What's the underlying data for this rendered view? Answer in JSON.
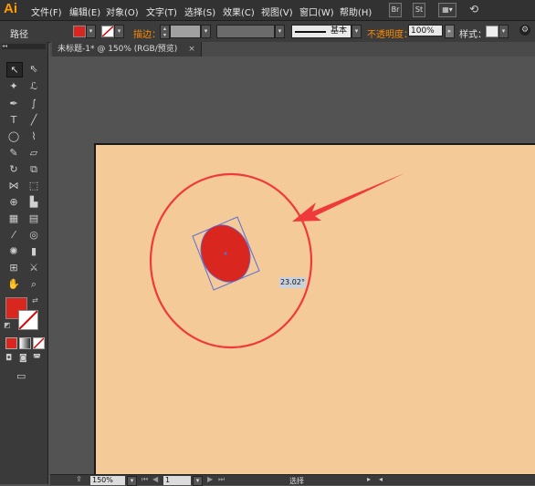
{
  "app": {
    "logo": "Ai"
  },
  "menu": [
    "文件(F)",
    "编辑(E)",
    "对象(O)",
    "文字(T)",
    "选择(S)",
    "效果(C)",
    "视图(V)",
    "窗口(W)",
    "帮助(H)"
  ],
  "menubar_icons": {
    "br": "Br",
    "st": "St"
  },
  "control_bar": {
    "selection_label": "路径",
    "stroke_label": "描边：",
    "stroke_style": "基本",
    "opacity_label": "不透明度：",
    "opacity_value": "100%",
    "style_label": "样式："
  },
  "document": {
    "tab_title": "未标题-1* @ 150% (RGB/预览)",
    "close_glyph": "×"
  },
  "canvas": {
    "rotation_tooltip": "23.02°"
  },
  "status_bar": {
    "zoom": "150%",
    "artboard_number": "1",
    "tool_name": "选择"
  },
  "colors": {
    "fill": "#d9271f",
    "artboard": "#f4ca98",
    "annotation": "#f0393a",
    "bounding_box": "#5a6ed6"
  },
  "icons": [
    "selection-tool-icon",
    "direct-selection-tool-icon",
    "magic-wand-icon",
    "lasso-icon",
    "pen-icon",
    "curvature-icon",
    "type-icon",
    "line-icon",
    "ellipse-icon",
    "paintbrush-icon",
    "pencil-icon",
    "eraser-icon",
    "rotate-icon",
    "scale-icon",
    "width-icon",
    "free-transform-icon",
    "shape-builder-icon",
    "perspective-icon",
    "mesh-icon",
    "gradient-icon",
    "eyedropper-icon",
    "blend-icon",
    "symbol-sprayer-icon",
    "graph-icon",
    "artboard-icon",
    "slice-icon",
    "hand-icon",
    "zoom-icon"
  ]
}
